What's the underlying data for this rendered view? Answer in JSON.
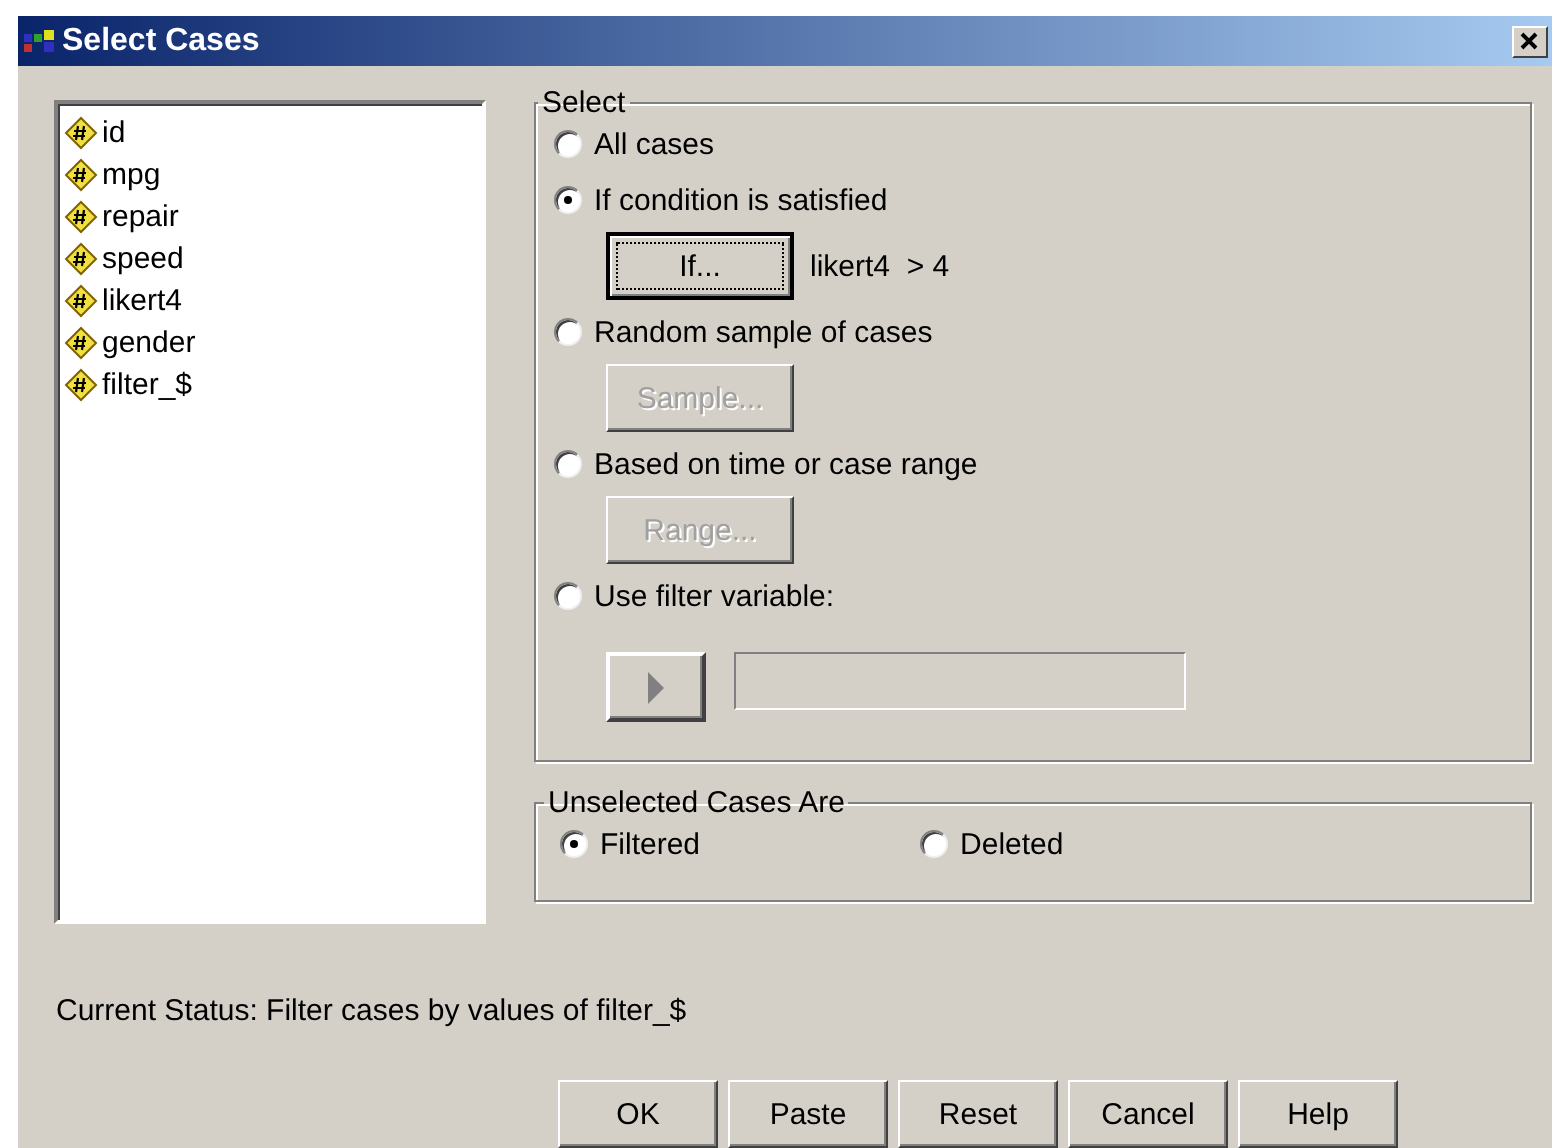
{
  "window": {
    "title": "Select Cases"
  },
  "variables": [
    "id",
    "mpg",
    "repair",
    "speed",
    "likert4",
    "gender",
    "filter_$"
  ],
  "select": {
    "title": "Select",
    "items": [
      {
        "kind": "radio",
        "label": "All cases",
        "selected": false
      },
      {
        "kind": "radio",
        "label": "If condition is satisfied",
        "selected": true
      },
      {
        "kind": "button",
        "label": "If...",
        "disabled": false,
        "focused": true,
        "value": "likert4  > 4"
      },
      {
        "kind": "radio",
        "label": "Random sample of cases",
        "selected": false
      },
      {
        "kind": "button",
        "label": "Sample...",
        "disabled": true,
        "focused": false
      },
      {
        "kind": "radio",
        "label": "Based on time or case range",
        "selected": false
      },
      {
        "kind": "button",
        "label": "Range...",
        "disabled": true,
        "focused": false
      },
      {
        "kind": "radio",
        "label": "Use filter variable:",
        "selected": false
      },
      {
        "kind": "arrow_field",
        "disabled": true
      }
    ]
  },
  "unselected": {
    "title": "Unselected Cases Are",
    "options": [
      {
        "label": "Filtered",
        "selected": true
      },
      {
        "label": "Deleted",
        "selected": false
      }
    ]
  },
  "status": "Current Status: Filter cases by values of filter_$",
  "buttons": [
    "OK",
    "Paste",
    "Reset",
    "Cancel",
    "Help"
  ]
}
